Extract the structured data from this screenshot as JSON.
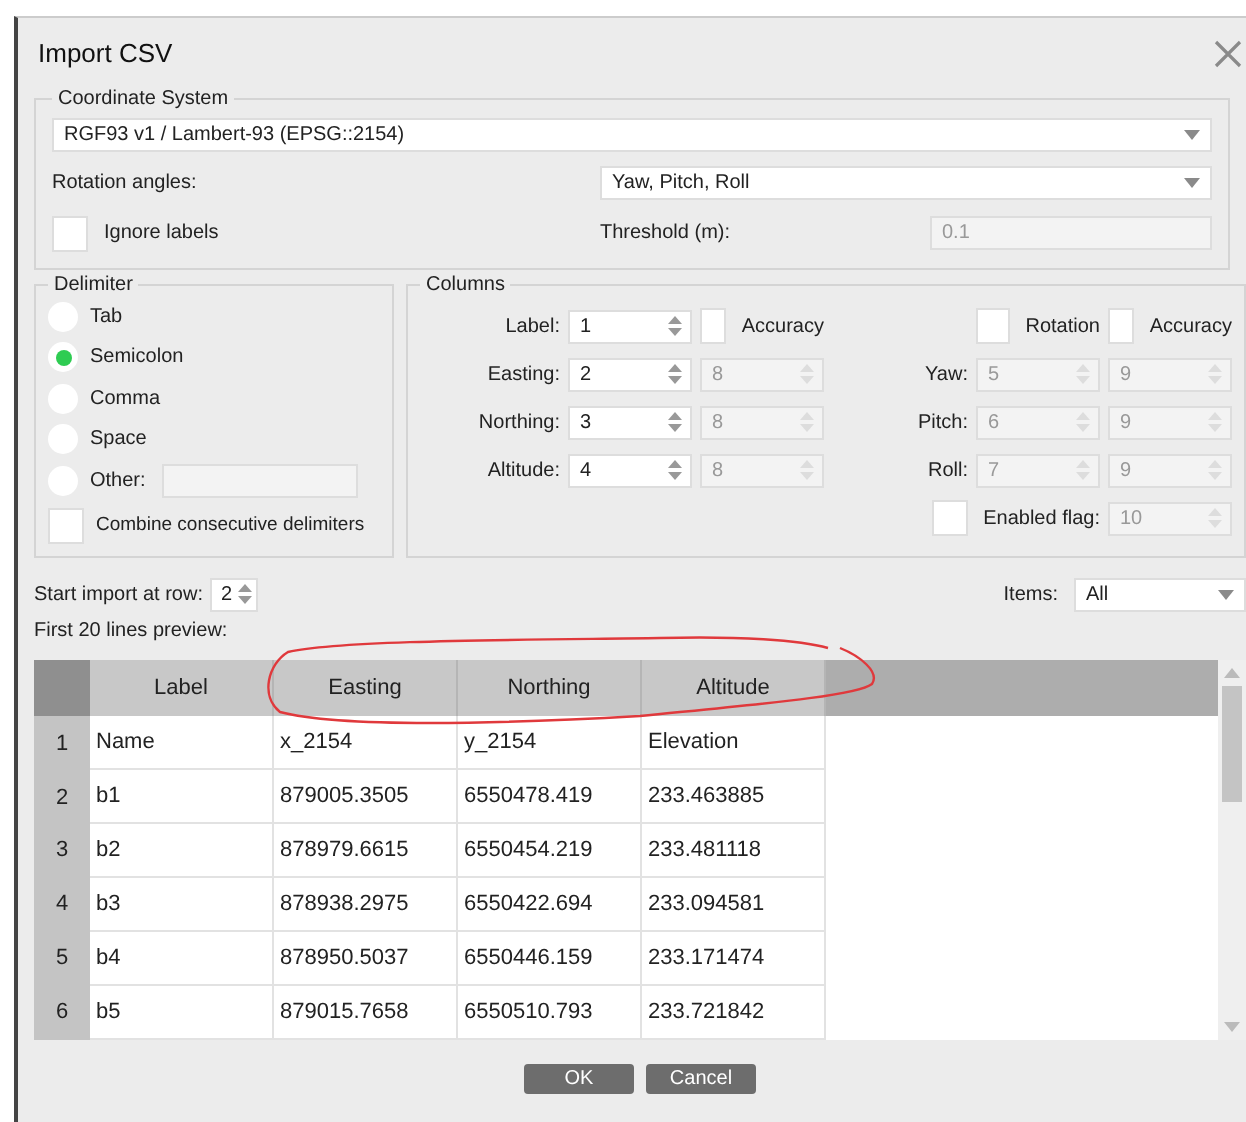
{
  "window": {
    "title": "Import CSV"
  },
  "coordinate_system": {
    "title": "Coordinate System",
    "crs": "RGF93 v1 / Lambert-93 (EPSG::2154)",
    "rotation_label": "Rotation angles:",
    "rotation_value": "Yaw, Pitch, Roll",
    "ignore_labels": {
      "label": "Ignore labels",
      "checked": false
    },
    "threshold_label": "Threshold (m):",
    "threshold_value": "0.1"
  },
  "delimiter": {
    "title": "Delimiter",
    "options": [
      {
        "label": "Tab",
        "selected": false,
        "kind": "plain"
      },
      {
        "label": "Semicolon",
        "selected": true,
        "kind": "plain"
      },
      {
        "label": "Comma",
        "selected": false,
        "kind": "plain"
      },
      {
        "label": "Space",
        "selected": false,
        "kind": "plain"
      },
      {
        "label": "Other:",
        "selected": false,
        "kind": "other"
      }
    ],
    "combine": {
      "label": "Combine consecutive delimiters",
      "checked": false
    }
  },
  "columns": {
    "title": "Columns",
    "accuracy_check": {
      "label": "Accuracy",
      "checked": false
    },
    "fields": [
      {
        "label": "Label:",
        "value": "1"
      },
      {
        "label": "Easting:",
        "value": "2",
        "accuracy": "8"
      },
      {
        "label": "Northing:",
        "value": "3",
        "accuracy": "8"
      },
      {
        "label": "Altitude:",
        "value": "4",
        "accuracy": "8"
      }
    ],
    "rotation_check": {
      "label": "Rotation",
      "checked": false
    },
    "rotation_accuracy_check": {
      "label": "Accuracy",
      "checked": false
    },
    "rotation_fields": [
      {
        "label": "Yaw:",
        "value": "5",
        "accuracy": "9"
      },
      {
        "label": "Pitch:",
        "value": "6",
        "accuracy": "9"
      },
      {
        "label": "Roll:",
        "value": "7",
        "accuracy": "9"
      }
    ],
    "enabled_flag": {
      "label": "Enabled flag:",
      "checked": false,
      "value": "10"
    }
  },
  "start_row": {
    "label": "Start import at row:",
    "value": "2"
  },
  "items": {
    "label": "Items:",
    "value": "All"
  },
  "preview_label": "First 20 lines preview:",
  "table": {
    "columns": [
      "Label",
      "Easting",
      "Northing",
      "Altitude"
    ],
    "rows": [
      {
        "number": "1",
        "cells": [
          "Name",
          "x_2154",
          "y_2154",
          "Elevation"
        ]
      },
      {
        "number": "2",
        "cells": [
          "b1",
          "879005.3505",
          "6550478.419",
          "233.463885"
        ]
      },
      {
        "number": "3",
        "cells": [
          "b2",
          "878979.6615",
          "6550454.219",
          "233.481118"
        ]
      },
      {
        "number": "4",
        "cells": [
          "b3",
          "878938.2975",
          "6550422.694",
          "233.094581"
        ]
      },
      {
        "number": "5",
        "cells": [
          "b4",
          "878950.5037",
          "6550446.159",
          "233.171474"
        ]
      },
      {
        "number": "6",
        "cells": [
          "b5",
          "879015.7658",
          "6550510.793",
          "233.721842"
        ]
      }
    ]
  },
  "buttons": [
    "OK",
    "Cancel"
  ]
}
